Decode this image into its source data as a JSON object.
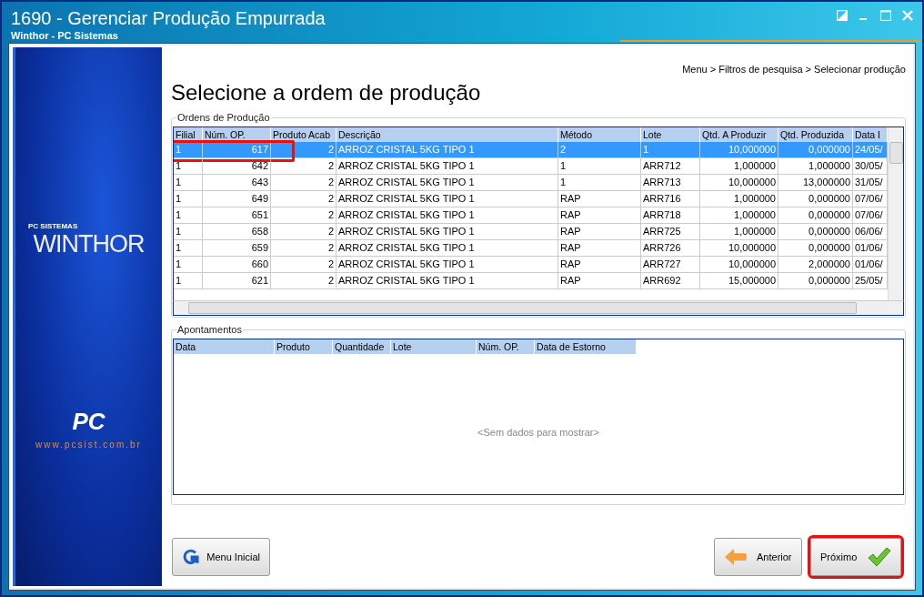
{
  "window": {
    "title": "1690 - Gerenciar Produção Empurrada",
    "subtitle": "Winthor - PC Sistemas"
  },
  "sidebar": {
    "caption": "PC SISTEMAS",
    "logo": "WINTHOR",
    "badge": "PC",
    "url": "www.pcsist.com.br"
  },
  "breadcrumb": "Menu > Filtros de pesquisa > Selecionar produção",
  "heading": "Selecione a ordem de produção",
  "orders": {
    "label": "Ordens de Produção",
    "columns": [
      "Filial",
      "Núm. OP.",
      "Produto Acab",
      "Descrição",
      "Método",
      "Lote",
      "Qtd. A Produzir",
      "Qtd. Produzida",
      "Data I"
    ],
    "rows": [
      {
        "selected": true,
        "highlighted": true,
        "cells": [
          "1",
          "617",
          "2",
          "ARROZ CRISTAL 5KG TIPO 1",
          "2",
          "1",
          "10,000000",
          "0,000000",
          "24/05/"
        ]
      },
      {
        "selected": false,
        "highlighted": false,
        "cells": [
          "1",
          "642",
          "2",
          "ARROZ CRISTAL 5KG TIPO 1",
          "1",
          "ARR712",
          "1,000000",
          "1,000000",
          "30/05/"
        ]
      },
      {
        "selected": false,
        "highlighted": false,
        "cells": [
          "1",
          "643",
          "2",
          "ARROZ CRISTAL 5KG TIPO 1",
          "1",
          "ARR713",
          "10,000000",
          "13,000000",
          "31/05/"
        ]
      },
      {
        "selected": false,
        "highlighted": false,
        "cells": [
          "1",
          "649",
          "2",
          "ARROZ CRISTAL 5KG TIPO 1",
          "RAP",
          "ARR716",
          "1,000000",
          "0,000000",
          "07/06/"
        ]
      },
      {
        "selected": false,
        "highlighted": false,
        "cells": [
          "1",
          "651",
          "2",
          "ARROZ CRISTAL 5KG TIPO 1",
          "RAP",
          "ARR718",
          "1,000000",
          "0,000000",
          "07/06/"
        ]
      },
      {
        "selected": false,
        "highlighted": false,
        "cells": [
          "1",
          "658",
          "2",
          "ARROZ CRISTAL 5KG TIPO 1",
          "RAP",
          "ARR725",
          "1,000000",
          "0,000000",
          "06/06/"
        ]
      },
      {
        "selected": false,
        "highlighted": false,
        "cells": [
          "1",
          "659",
          "2",
          "ARROZ CRISTAL 5KG TIPO 1",
          "RAP",
          "ARR726",
          "10,000000",
          "0,000000",
          "01/06/"
        ]
      },
      {
        "selected": false,
        "highlighted": false,
        "cells": [
          "1",
          "660",
          "2",
          "ARROZ CRISTAL 5KG TIPO 1",
          "RAP",
          "ARR727",
          "10,000000",
          "2,000000",
          "01/06/"
        ]
      },
      {
        "selected": false,
        "highlighted": false,
        "cells": [
          "1",
          "621",
          "2",
          "ARROZ CRISTAL 5KG TIPO 1",
          "RAP",
          "ARR692",
          "15,000000",
          "0,000000",
          "25/05/"
        ]
      }
    ]
  },
  "entries": {
    "label": "Apontamentos",
    "columns": [
      "Data",
      "Produto",
      "Quantidade",
      "Lote",
      "Núm. OP.",
      "Data de Estorno"
    ],
    "empty_text": "<Sem dados para mostrar>"
  },
  "buttons": [
    {
      "kind": "home",
      "label": "Menu Inicial",
      "highlighted": false
    },
    {
      "kind": "back",
      "label": "Anterior",
      "highlighted": false
    },
    {
      "kind": "next",
      "label": "Próximo",
      "highlighted": true
    }
  ]
}
